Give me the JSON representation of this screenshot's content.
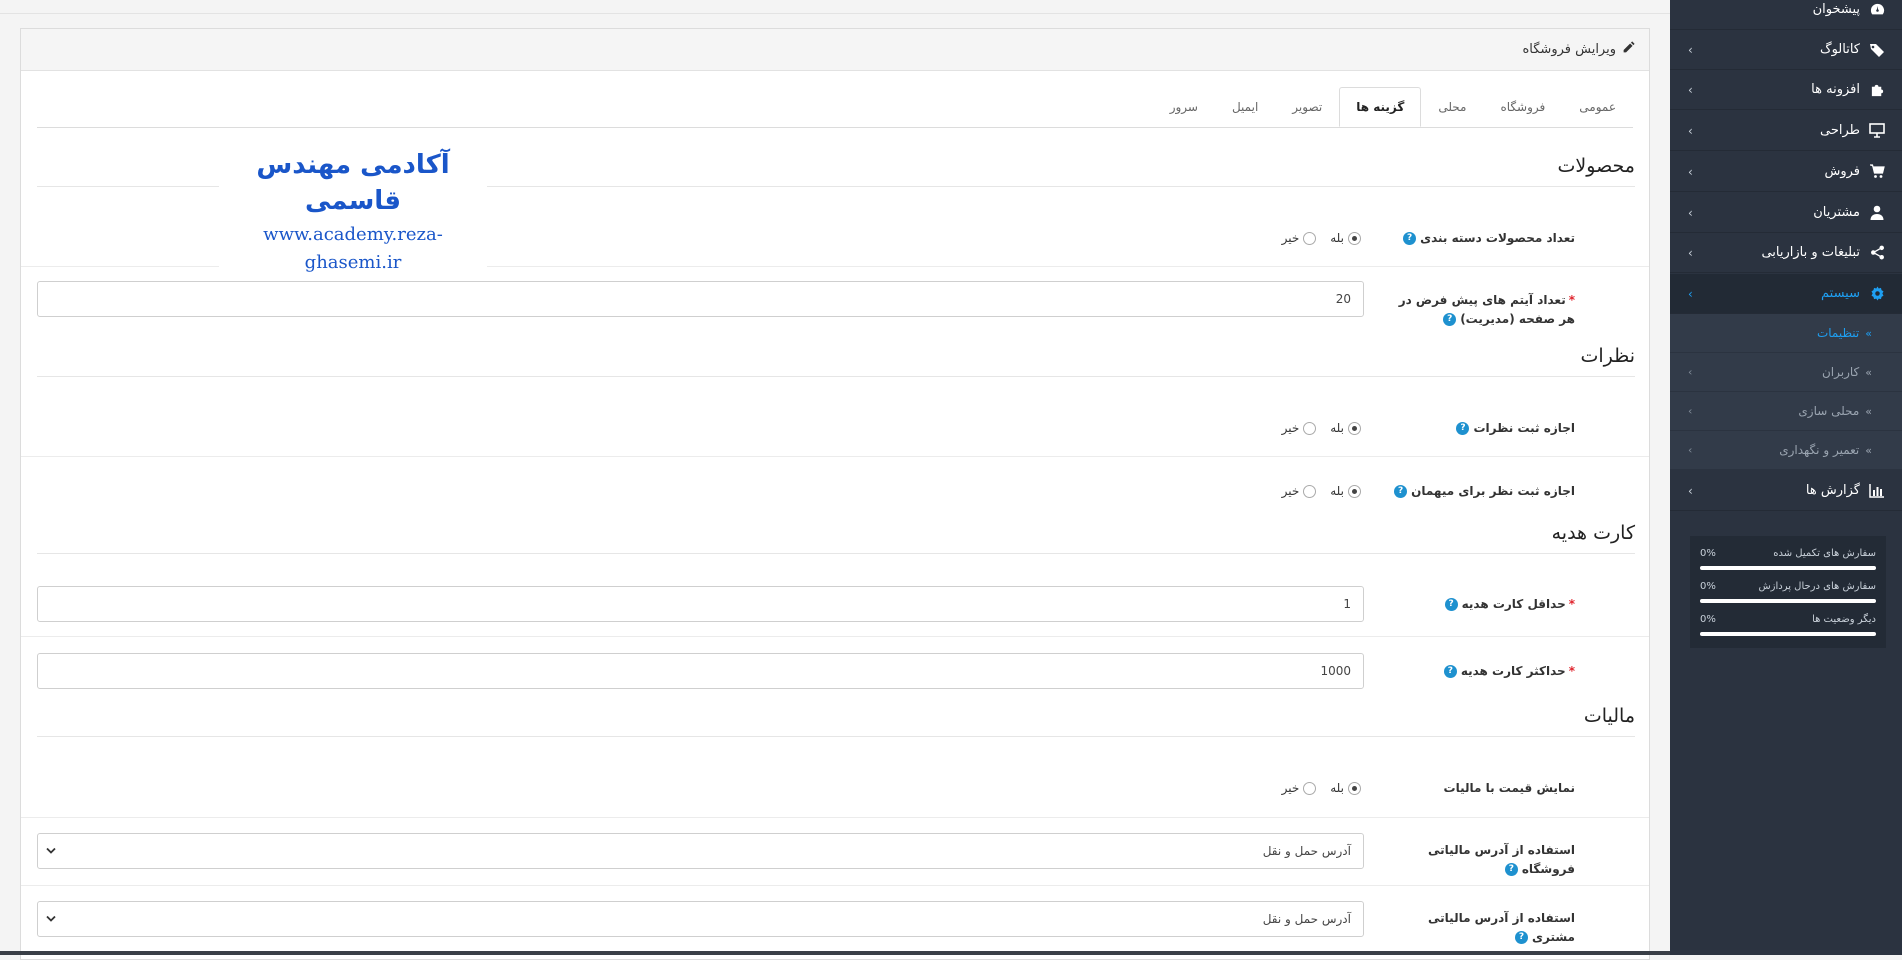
{
  "sidebar": {
    "items": [
      {
        "label": "پیشخوان",
        "icon": "dashboard-icon",
        "arrow": ""
      },
      {
        "label": "کاتالوگ",
        "icon": "tag-icon",
        "arrow": "›"
      },
      {
        "label": "افزونه ها",
        "icon": "puzzle-icon",
        "arrow": "›"
      },
      {
        "label": "طراحی",
        "icon": "monitor-icon",
        "arrow": "›"
      },
      {
        "label": "فروش",
        "icon": "cart-icon",
        "arrow": "›"
      },
      {
        "label": "مشتریان",
        "icon": "user-icon",
        "arrow": "›"
      },
      {
        "label": "تبلیغات و بازاریابی",
        "icon": "share-icon",
        "arrow": "›"
      },
      {
        "label": "سیستم",
        "icon": "gear-icon",
        "arrow": "›"
      }
    ],
    "subitems": [
      {
        "label": "تنظیمات",
        "chev": "»",
        "arrow": ""
      },
      {
        "label": "کاربران",
        "chev": "»",
        "arrow": "›"
      },
      {
        "label": "محلی سازی",
        "chev": "»",
        "arrow": "›"
      },
      {
        "label": "تعمیر و نگهداری",
        "chev": "»",
        "arrow": "›"
      }
    ],
    "reports": {
      "label": "گزارش ها",
      "icon": "bar-chart-icon",
      "arrow": "›"
    },
    "stats": [
      {
        "label": "سفارش های تکمیل شده",
        "value": "0%",
        "progress": 0
      },
      {
        "label": "سفارش های درحال پردازش",
        "value": "0%",
        "progress": 0
      },
      {
        "label": "دیگر وضعیت ها",
        "value": "0%",
        "progress": 0
      }
    ],
    "accent_color": "#1e9ff2",
    "background_color": "#2b3340"
  },
  "panel": {
    "title": "ویرایش فروشگاه",
    "title_icon": "pencil-icon"
  },
  "tabs": [
    {
      "label": "عمومی"
    },
    {
      "label": "فروشگاه"
    },
    {
      "label": "محلی"
    },
    {
      "label": "گزینه ها",
      "active": true
    },
    {
      "label": "تصویر"
    },
    {
      "label": "ایمیل"
    },
    {
      "label": "سرور"
    }
  ],
  "watermark": {
    "title": "آکادمی مهندس قاسمی",
    "url": "www.academy.reza-ghasemi.ir"
  },
  "sections": {
    "products": {
      "legend": "محصولات",
      "category_count": {
        "label": "تعداد محصولات دسته بندی",
        "yes": "بله",
        "no": "خیر",
        "selected": "yes"
      },
      "admin_limit": {
        "label": "تعداد آیتم های پیش فرض در هر صفحه (مدیریت)",
        "value": "20"
      }
    },
    "reviews": {
      "legend": "نظرات",
      "allow_reviews": {
        "label": "اجازه ثبت نظرات",
        "yes": "بله",
        "no": "خیر",
        "selected": "yes"
      },
      "guest_reviews": {
        "label": "اجازه ثبت نظر برای میهمان",
        "yes": "بله",
        "no": "خیر",
        "selected": "yes"
      }
    },
    "voucher": {
      "legend": "کارت هدیه",
      "min": {
        "label": "حداقل کارت هدیه",
        "value": "1"
      },
      "max": {
        "label": "حداکثر کارت هدیه",
        "value": "1000"
      }
    },
    "tax": {
      "legend": "مالیات",
      "show_price_tax": {
        "label": "نمایش قیمت با مالیات",
        "yes": "بله",
        "no": "خیر",
        "selected": "yes"
      },
      "store_tax_address": {
        "label": "استفاده از آدرس مالیاتی فروشگاه",
        "value": "آدرس حمل و نقل"
      },
      "customer_tax_address": {
        "label": "استفاده از آدرس مالیاتی مشتری",
        "value": "آدرس حمل و نقل"
      }
    }
  },
  "help_symbol": "?",
  "required_symbol": "*"
}
